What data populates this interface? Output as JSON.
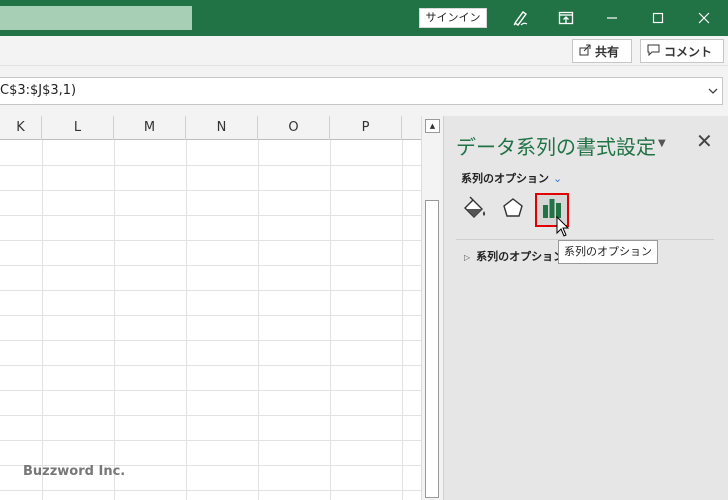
{
  "titlebar": {
    "signin_label": "サインイン",
    "icons": [
      "pen-icon",
      "ribbon-display-icon",
      "minimize-icon",
      "maximize-icon",
      "close-icon"
    ]
  },
  "ribbon": {
    "share_label": "共有",
    "comment_label": "コメント"
  },
  "formula": {
    "text": "C$3:$J$3,1)"
  },
  "grid": {
    "columns": [
      "K",
      "L",
      "M",
      "N",
      "O",
      "P"
    ],
    "watermark": "Buzzword Inc."
  },
  "pane": {
    "title": "データ系列の書式設定",
    "options_dropdown": "系列のオプション",
    "tabs": [
      "fill-line-icon",
      "effects-icon",
      "series-options-icon"
    ],
    "section": "系列のオプション",
    "tooltip": "系列のオプション"
  },
  "colors": {
    "accent": "#217346",
    "highlight": "#e00000"
  }
}
